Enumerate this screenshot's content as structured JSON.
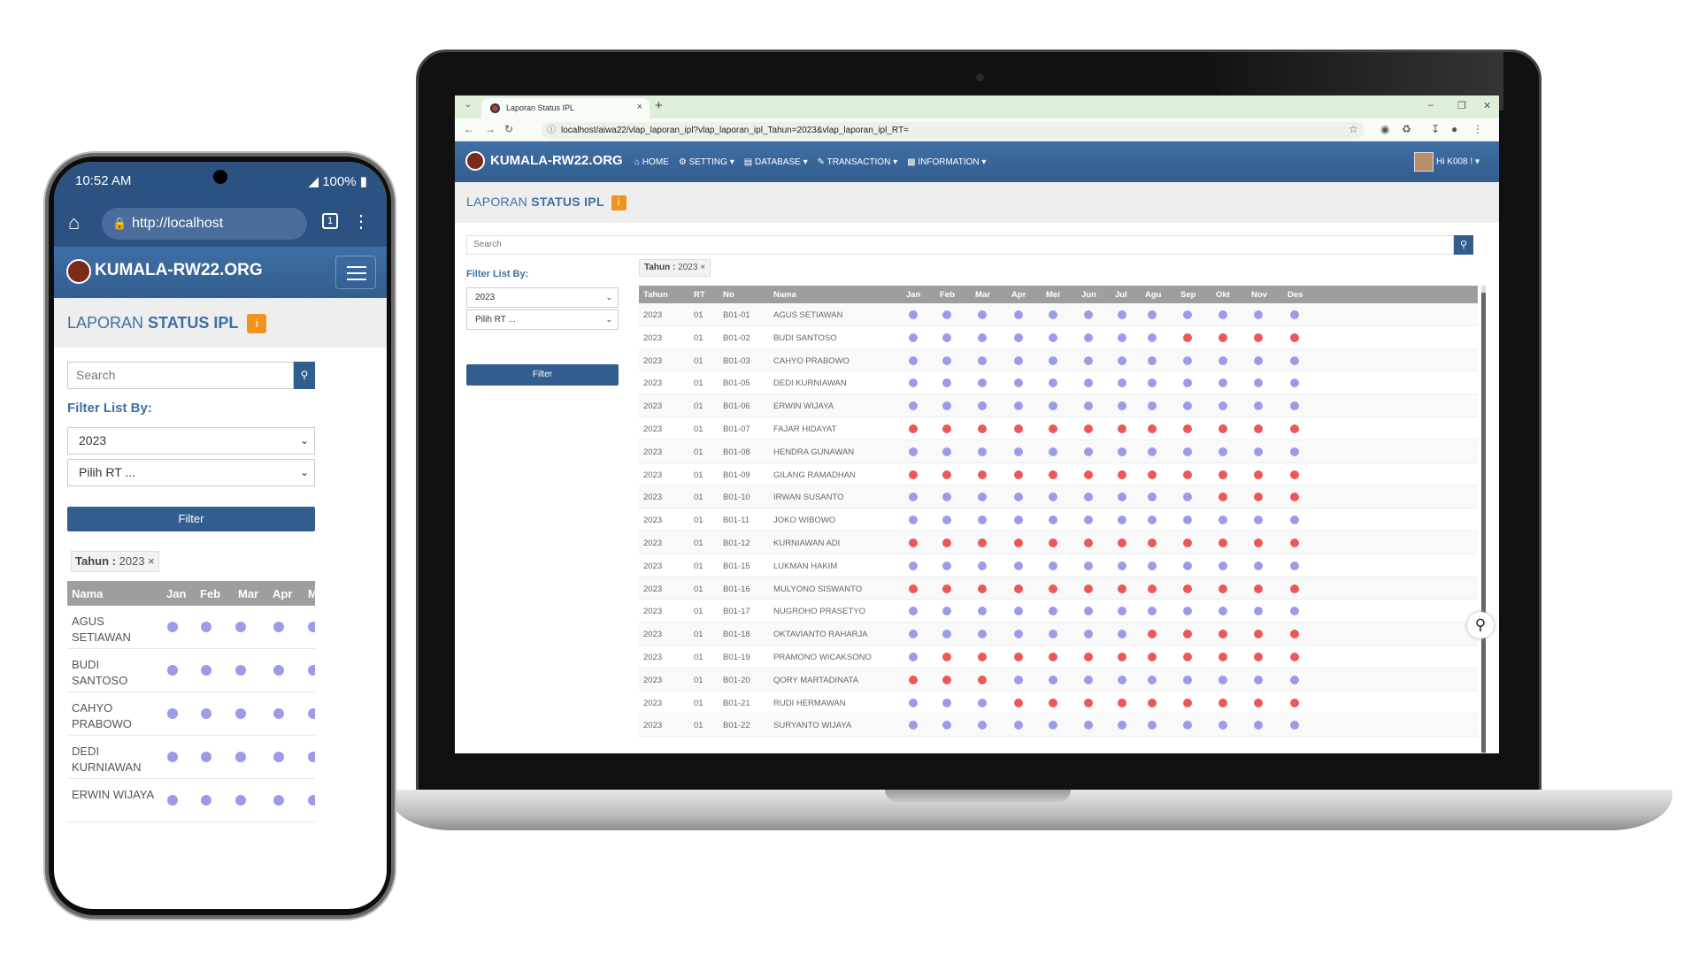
{
  "laptop": {
    "tab_title": "Laporan Status IPL",
    "url": "localhost/aiwa22/vlap_laporan_ipl?vlap_laporan_ipl_Tahun=2023&vlap_laporan_ipl_RT=",
    "brand": "KUMALA-RW22.ORG",
    "menu": [
      "HOME",
      "SETTING",
      "DATABASE",
      "TRANSACTION",
      "INFORMATION"
    ],
    "user_greeting": "Hi K008 !",
    "page_title_a": "LAPORAN ",
    "page_title_b": "STATUS IPL",
    "search_placeholder": "Search",
    "filter_label": "Filter List By:",
    "year_select": "2023",
    "rt_select": "Pilih RT ...",
    "filter_button": "Filter",
    "chip_label": "Tahun :",
    "chip_value": "2023",
    "columns": [
      "Tahun",
      "RT",
      "No",
      "Nama",
      "Jan",
      "Feb",
      "Mar",
      "Apr",
      "Mei",
      "Jun",
      "Jul",
      "Agu",
      "Sep",
      "Okt",
      "Nov",
      "Des"
    ],
    "rows": [
      {
        "tahun": "2023",
        "rt": "01",
        "no": "B01-01",
        "nama": "AGUS SETIAWAN",
        "status": "PPPPPPPPPPPP"
      },
      {
        "tahun": "2023",
        "rt": "01",
        "no": "B01-02",
        "nama": "BUDI SANTOSO",
        "status": "PPPPPPPPRRRR"
      },
      {
        "tahun": "2023",
        "rt": "01",
        "no": "B01-03",
        "nama": "CAHYO PRABOWO",
        "status": "PPPPPPPPPPPP"
      },
      {
        "tahun": "2023",
        "rt": "01",
        "no": "B01-05",
        "nama": "DEDI KURNIAWAN",
        "status": "PPPPPPPPPPPP"
      },
      {
        "tahun": "2023",
        "rt": "01",
        "no": "B01-06",
        "nama": "ERWIN WIJAYA",
        "status": "PPPPPPPPPPPP"
      },
      {
        "tahun": "2023",
        "rt": "01",
        "no": "B01-07",
        "nama": "FAJAR HIDAYAT",
        "status": "RRRRRRRRRRRR"
      },
      {
        "tahun": "2023",
        "rt": "01",
        "no": "B01-08",
        "nama": "HENDRA GUNAWAN",
        "status": "PPPPPPPPPPPP"
      },
      {
        "tahun": "2023",
        "rt": "01",
        "no": "B01-09",
        "nama": "GILANG RAMADHAN",
        "status": "RRRRRRRRRRRR"
      },
      {
        "tahun": "2023",
        "rt": "01",
        "no": "B01-10",
        "nama": "IRWAN SUSANTO",
        "status": "PPPPPPPPPRRR"
      },
      {
        "tahun": "2023",
        "rt": "01",
        "no": "B01-11",
        "nama": "JOKO WIBOWO",
        "status": "PPPPPPPPPPPP"
      },
      {
        "tahun": "2023",
        "rt": "01",
        "no": "B01-12",
        "nama": "KURNIAWAN ADI",
        "status": "RRRRRRRRRRRR"
      },
      {
        "tahun": "2023",
        "rt": "01",
        "no": "B01-15",
        "nama": "LUKMAN HAKIM",
        "status": "PPPPPPPPPPPP"
      },
      {
        "tahun": "2023",
        "rt": "01",
        "no": "B01-16",
        "nama": "MULYONO SISWANTO",
        "status": "RRRRRRRRRRRR"
      },
      {
        "tahun": "2023",
        "rt": "01",
        "no": "B01-17",
        "nama": "NUGROHO PRASETYO",
        "status": "PPPPPPPPPPPP"
      },
      {
        "tahun": "2023",
        "rt": "01",
        "no": "B01-18",
        "nama": "OKTAVIANTO RAHARJA",
        "status": "PPPPPPPRRRRR"
      },
      {
        "tahun": "2023",
        "rt": "01",
        "no": "B01-19",
        "nama": "PRAMONO WICAKSONO",
        "status": "PRRRRRRRRRRR"
      },
      {
        "tahun": "2023",
        "rt": "01",
        "no": "B01-20",
        "nama": "QORY MARTADINATA",
        "status": "RRRPPPPPPPPP"
      },
      {
        "tahun": "2023",
        "rt": "01",
        "no": "B01-21",
        "nama": "RUDI HERMAWAN",
        "status": "PPPRRRRRRRRR"
      },
      {
        "tahun": "2023",
        "rt": "01",
        "no": "B01-22",
        "nama": "SURYANTO WIJAYA",
        "status": "PPPPPPPPPPPP"
      }
    ]
  },
  "phone": {
    "time": "10:52 AM",
    "battery": "100%",
    "url": "http://localhost",
    "tab_count": "1",
    "brand": "KUMALA-RW22.ORG",
    "page_title_a": "LAPORAN ",
    "page_title_b": "STATUS IPL",
    "search_placeholder": "Search",
    "filter_label": "Filter List By:",
    "year_select": "2023",
    "rt_select": "Pilih RT ...",
    "filter_button": "Filter",
    "chip_label": "Tahun :",
    "chip_value": "2023",
    "columns": [
      "Nama",
      "Jan",
      "Feb",
      "Mar",
      "Apr",
      "M"
    ],
    "rows": [
      {
        "nama": "AGUS SETIAWAN"
      },
      {
        "nama": "BUDI SANTOSO"
      },
      {
        "nama": "CAHYO PRABOWO"
      },
      {
        "nama": "DEDI KURNIAWAN"
      },
      {
        "nama": "ERWIN WIJAYA"
      }
    ]
  },
  "colors": {
    "paid": "#9b9bea",
    "unpaid": "#ec5757",
    "brand": "#325d8f",
    "accent": "#f0941d"
  }
}
